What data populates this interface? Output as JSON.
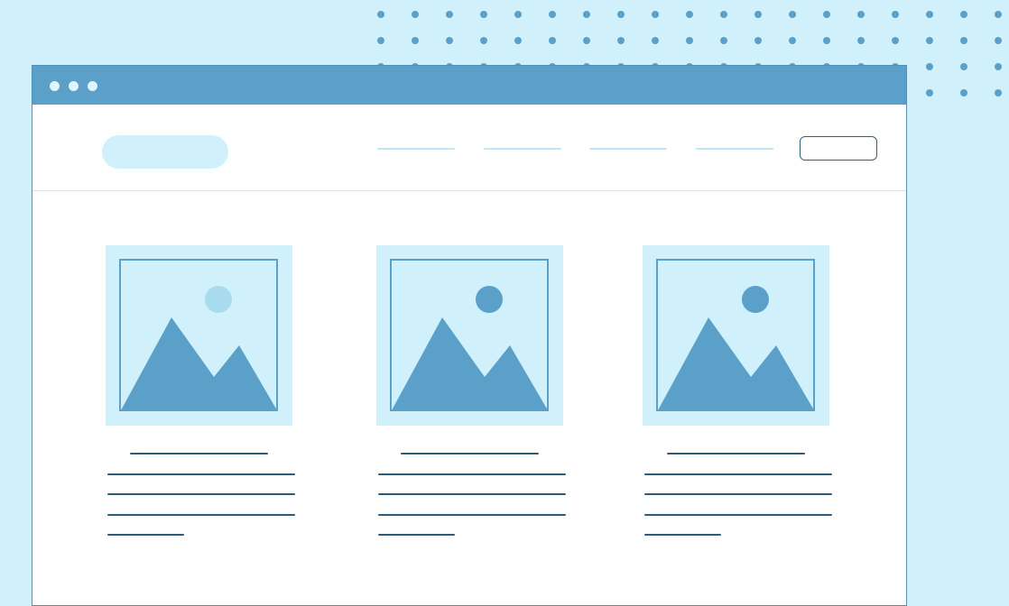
{
  "window": {
    "title": "",
    "controls": [
      "close",
      "minimize",
      "maximize"
    ]
  },
  "header": {
    "logo": "",
    "nav_links": [
      "",
      "",
      "",
      ""
    ],
    "action_button_label": ""
  },
  "cards": [
    {
      "image": "image-placeholder-icon",
      "title": "",
      "text_lines": [
        "",
        "",
        "",
        ""
      ]
    },
    {
      "image": "image-placeholder-icon",
      "title": "",
      "text_lines": [
        "",
        "",
        "",
        ""
      ]
    },
    {
      "image": "image-placeholder-icon",
      "title": "",
      "text_lines": [
        "",
        "",
        "",
        ""
      ]
    }
  ],
  "colors": {
    "background": "#d0f1fb",
    "titlebar": "#5aa0c9",
    "accent": "#5aa0c9",
    "text_lines": "#2e5c78"
  }
}
